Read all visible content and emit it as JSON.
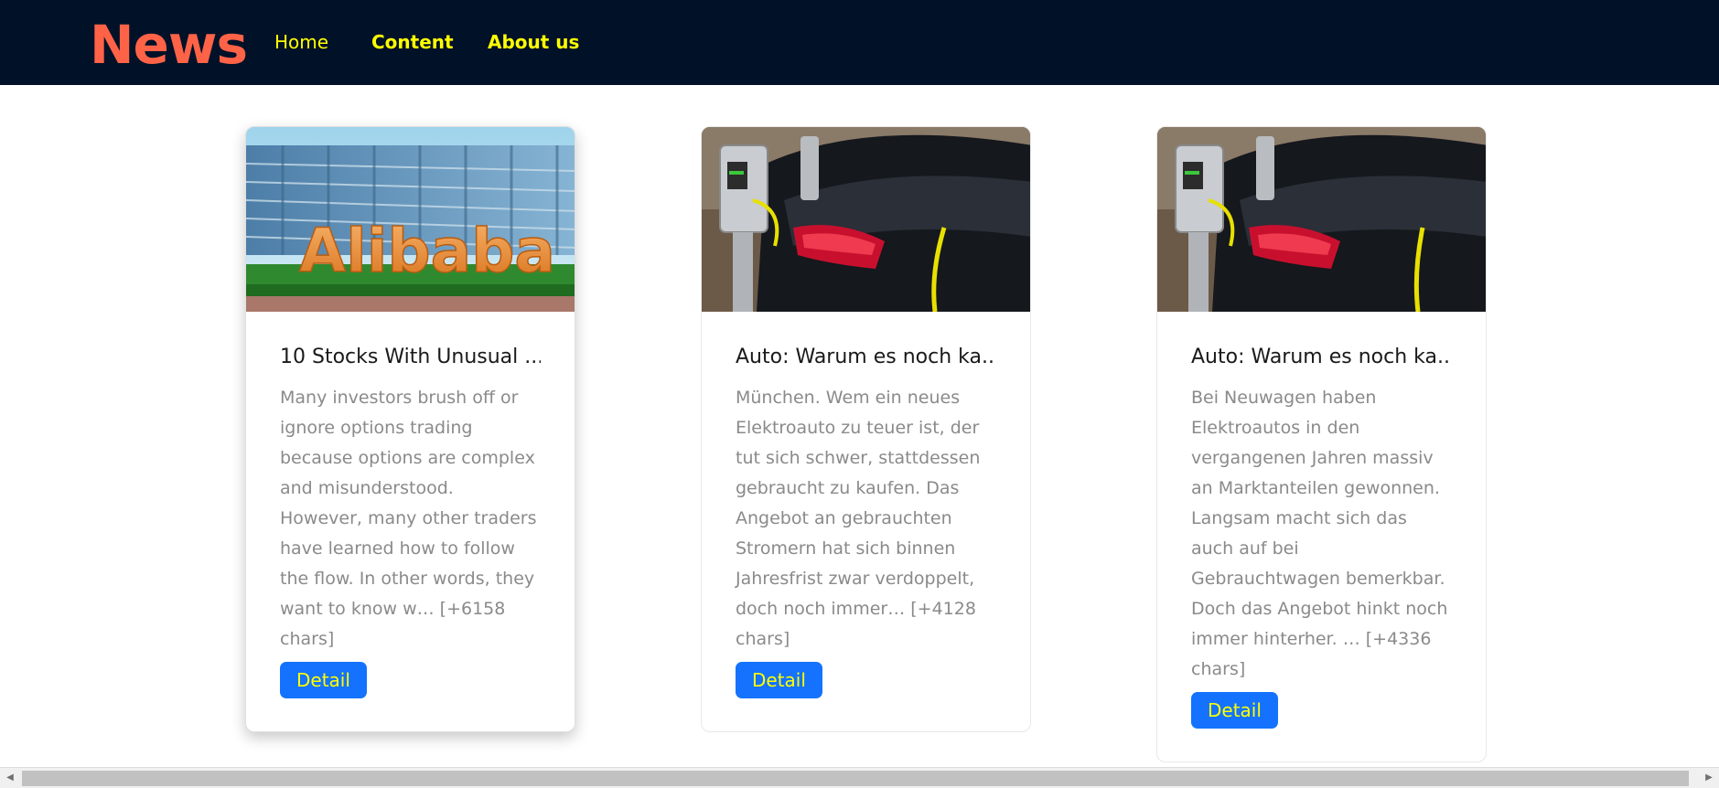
{
  "brand": "News",
  "nav": {
    "home": "Home",
    "content": "Content",
    "about": "About us"
  },
  "cards": [
    {
      "title": "10 Stocks With Unusual ...",
      "text": "Many investors brush off or ignore options trading because options are complex and misunderstood. However, many other traders have learned how to follow the flow. In other words, they want to know w… [+6158 chars]",
      "button": "Detail",
      "image_subject": "Alibaba"
    },
    {
      "title": "Auto: Warum es noch ka...",
      "text": "München. Wem ein neues Elektroauto zu teuer ist, der tut sich schwer, stattdessen gebraucht zu kaufen. Das Angebot an gebrauchten Stromern hat sich binnen Jahresfrist zwar verdoppelt, doch noch immer… [+4128 chars]",
      "button": "Detail",
      "image_subject": "electric car charging"
    },
    {
      "title": "Auto: Warum es noch ka...",
      "text": "Bei Neuwagen haben Elektroautos in den vergangenen Jahren massiv an Marktanteilen gewonnen. Langsam macht sich das auch auf bei Gebrauchtwagen bemerkbar. Doch das Angebot hinkt noch immer hinterher. … [+4336 chars]",
      "button": "Detail",
      "image_subject": "electric car charging"
    }
  ],
  "colors": {
    "navbar_bg": "#001128",
    "brand": "#ff6347",
    "nav_link": "#ffff00",
    "button_bg": "#1472ff",
    "button_text": "#ffff00"
  }
}
